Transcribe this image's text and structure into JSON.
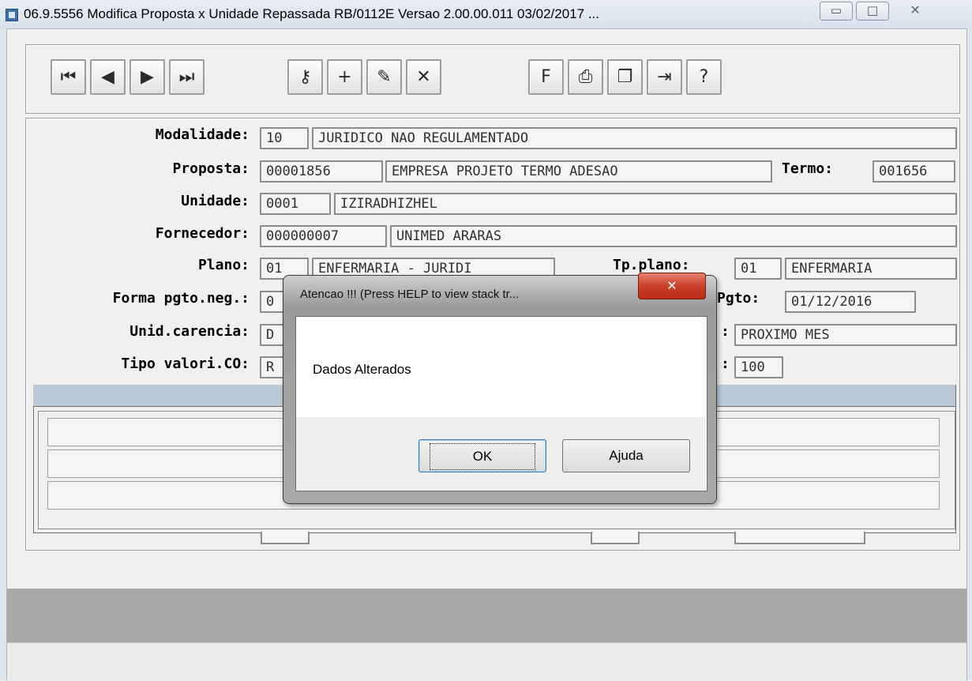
{
  "window": {
    "title": "06.9.5556  Modifica  Proposta x Unidade Repassada RB/0112E Versao 2.00.00.011 03/02/2017 ...",
    "minimize_glyph": "▭",
    "maximize_glyph": "□",
    "close_glyph": "✕"
  },
  "toolbar": {
    "buttons": [
      {
        "name": "first-record-icon",
        "glyph": "⏮"
      },
      {
        "name": "previous-record-icon",
        "glyph": "◀"
      },
      {
        "name": "next-record-icon",
        "glyph": "▶"
      },
      {
        "name": "last-record-icon",
        "glyph": "⏭"
      },
      {
        "name": "search-key-icon",
        "glyph": "⚷"
      },
      {
        "name": "add-record-icon",
        "glyph": "+"
      },
      {
        "name": "edit-record-icon",
        "glyph": "✎"
      },
      {
        "name": "delete-record-icon",
        "glyph": "✕"
      },
      {
        "name": "filter-icon",
        "glyph": "F"
      },
      {
        "name": "print-icon",
        "glyph": "⎙"
      },
      {
        "name": "copy-icon",
        "glyph": "❐"
      },
      {
        "name": "exit-icon",
        "glyph": "⇥"
      },
      {
        "name": "help-icon",
        "glyph": "?"
      }
    ]
  },
  "form": {
    "modalidade": {
      "label": "Modalidade:",
      "code": "10",
      "desc": "JURIDICO NAO REGULAMENTADO"
    },
    "proposta": {
      "label": "Proposta:",
      "code": "00001856",
      "desc": "EMPRESA PROJETO TERMO ADESAO",
      "termo_label": "Termo:",
      "termo_value": "001656"
    },
    "unidade": {
      "label": "Unidade:",
      "code": "0001",
      "desc": "IZIRADHIZHEL"
    },
    "fornecedor": {
      "label": "Fornecedor:",
      "code": "000000007",
      "desc": "UNIMED ARARAS"
    },
    "plano": {
      "label": "Plano:",
      "code": "01",
      "desc": "ENFERMARIA - JURIDI",
      "tp_label": "Tp.plano:",
      "tp_code": "01",
      "tp_desc": "ENFERMARIA"
    },
    "forma_pgto": {
      "label": "Forma pgto.neg.:",
      "code": "0",
      "right_label": "Pgto:",
      "right_value": "01/12/2016"
    },
    "unid_carencia": {
      "label": "Unid.carencia:",
      "code": "D",
      "right_label": ":",
      "right_value": "PROXIMO MES"
    },
    "tipo_valori": {
      "label": "Tipo valori.CO:",
      "code": "R",
      "right_label": ":",
      "right_value": "100"
    }
  },
  "dialog": {
    "title": "Atencao !!!  (Press HELP to view stack tr...",
    "close_glyph": "✕",
    "message": "Dados Alterados",
    "ok_label": "OK",
    "help_label": "Ajuda"
  }
}
